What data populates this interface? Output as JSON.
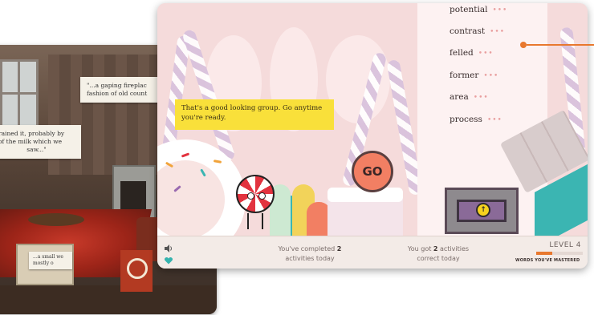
{
  "background_screen": {
    "quote_top": "\"...a gaping fireplac... fashion of old count...",
    "quote_top_line1": "\"...a gaping fireplac",
    "quote_top_line2": "fashion of old count",
    "quote_mid_line1": "rained it, probably by",
    "quote_mid_line2": "of the milk which we",
    "quote_mid_line3": "saw...\"",
    "quote_book_line1": "...a small we",
    "quote_book_line2": "mostly o"
  },
  "words": [
    {
      "word": "potential",
      "dots": "•••"
    },
    {
      "word": "contrast",
      "dots": "•••"
    },
    {
      "word": "felled",
      "dots": "•••"
    },
    {
      "word": "former",
      "dots": "•••"
    },
    {
      "word": "area",
      "dots": "•••"
    },
    {
      "word": "process",
      "dots": "•••"
    }
  ],
  "message": "That's a good looking group. Go anytime you're ready.",
  "go_button": "GO",
  "vault_arrow": "↑",
  "footer": {
    "completed_prefix": "You've completed ",
    "completed_count": "2",
    "completed_suffix": "activities today",
    "correct_prefix": "You got ",
    "correct_count": "2",
    "correct_mid": " activities",
    "correct_suffix": "correct today",
    "level": "LEVEL 4",
    "mastered_label": "WORDS YOU'VE MASTERED",
    "mastered_progress": 0.35
  },
  "icons": {
    "sound": "speaker-icon",
    "heart": "heart-icon"
  },
  "colors": {
    "accent": "#e8782e",
    "message_bg": "#f9e03a",
    "go_button": "#f27f63",
    "teal": "#3bb5b2"
  }
}
